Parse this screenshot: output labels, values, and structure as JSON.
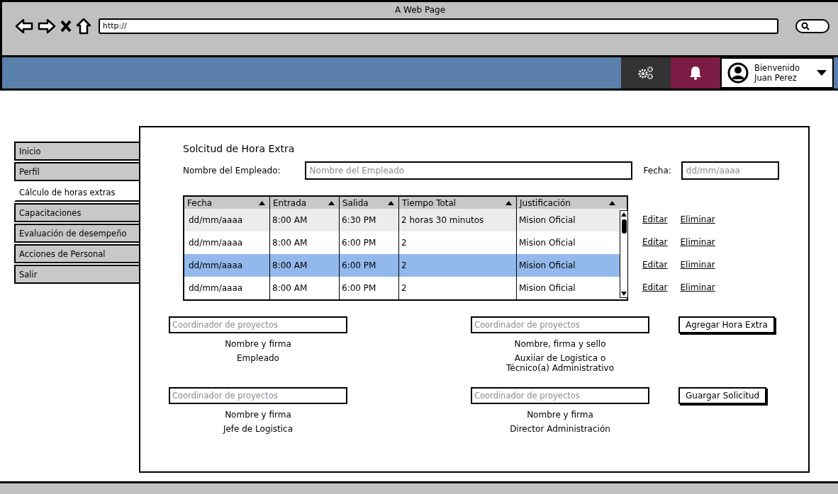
{
  "browser": {
    "title": "A Web Page",
    "url": "http://"
  },
  "header": {
    "greeting": "Bienvenido",
    "user_name": "Juan Perez"
  },
  "sidebar": {
    "items": [
      {
        "label": "Inicio",
        "selected": false
      },
      {
        "label": "Perfil",
        "selected": false
      },
      {
        "label": "Cálculo de horas extras",
        "selected": true
      },
      {
        "label": "Capacitaciones",
        "selected": false
      },
      {
        "label": "Evaluación de desempeño",
        "selected": false
      },
      {
        "label": "Acciones de Personal",
        "selected": false
      },
      {
        "label": "Salir",
        "selected": false
      }
    ]
  },
  "form": {
    "title": "Solcitud de Hora Extra",
    "employee_label": "Nombre del Empleado:",
    "employee_placeholder": "Nombre del Empleado",
    "date_label": "Fecha:",
    "date_placeholder": "dd/mm/aaaa"
  },
  "table": {
    "columns": [
      "Fecha",
      "Entrada",
      "Salida",
      "Tiempo Total",
      "Justificación"
    ],
    "rows": [
      {
        "cells": [
          "dd/mm/aaaa",
          "8:00 AM",
          "6:30 PM",
          "2 horas 30 minutos",
          "Mision Oficial"
        ],
        "selected": false,
        "actions": [
          "Editar",
          "Eliminar"
        ]
      },
      {
        "cells": [
          "dd/mm/aaaa",
          "8:00 AM",
          "6:00 PM",
          "2",
          "Mision Oficial"
        ],
        "selected": false,
        "actions": [
          "Editar",
          "Eliminar"
        ]
      },
      {
        "cells": [
          "dd/mm/aaaa",
          "8:00 AM",
          "6:00 PM",
          "2",
          "Mision Oficial"
        ],
        "selected": true,
        "actions": [
          "Editar",
          "Eliminar"
        ]
      },
      {
        "cells": [
          "dd/mm/aaaa",
          "8:00 AM",
          "6:00 PM",
          "2",
          "Mision Oficial"
        ],
        "selected": false,
        "actions": [
          "Editar",
          "Eliminar"
        ]
      }
    ]
  },
  "signatures": [
    {
      "placeholder": "Coordinador de proyectos",
      "caption": "Nombre y firma",
      "role": "Empleado"
    },
    {
      "placeholder": "Coordinador de proyectos",
      "caption": "Nombre, firma y sello",
      "role": "Auxiiar de Logistica o\nTécnico(a) Administrativo"
    },
    {
      "placeholder": "Coordinador de proyectos",
      "caption": "Nombre y firma",
      "role": "Jefe de Logistica"
    },
    {
      "placeholder": "Coordinador de proyectos",
      "caption": "Nombre y firma",
      "role": "Director Administración"
    }
  ],
  "buttons": [
    "Agregar Hora Extra",
    "Guargar Solicitud"
  ]
}
